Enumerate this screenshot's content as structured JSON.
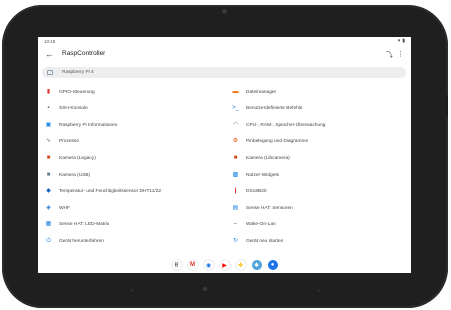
{
  "statusbar": {
    "time": "10:18"
  },
  "appbar": {
    "back": "←",
    "title": "RaspController",
    "action1": "⤵",
    "action2": "⋮"
  },
  "device_selector": {
    "label": "Raspberry Pi 4"
  },
  "menu": {
    "left": [
      {
        "label": "GPIO-Steuerung",
        "icon": "gpio-icon",
        "glyph": "▮",
        "color": "#e53935"
      },
      {
        "label": "SSH-Konsole",
        "icon": "terminal-icon",
        "glyph": "▪",
        "color": "#5f6368"
      },
      {
        "label": "Raspberry Pi Informationen",
        "icon": "info-icon",
        "glyph": "▣",
        "color": "#1e88e5"
      },
      {
        "label": "Prozesse",
        "icon": "activity-icon",
        "glyph": "∿",
        "color": "#5f6368"
      },
      {
        "label": "Kamera (Legacy)",
        "icon": "camera-icon",
        "glyph": "■",
        "color": "#d84315"
      },
      {
        "label": "Kamera (USB)",
        "icon": "webcam-icon",
        "glyph": "■",
        "color": "#607d8b"
      },
      {
        "label": "Temperatur- und Feuchtigkeitssensor DHT11/22",
        "icon": "sensor-icon",
        "glyph": "◆",
        "color": "#1565c0"
      },
      {
        "label": "WHF",
        "icon": "rf-icon",
        "glyph": "◈",
        "color": "#1976d2"
      },
      {
        "label": "Sense HAT: LED-Matrix",
        "icon": "led-matrix-icon",
        "glyph": "▦",
        "color": "#1e88e5"
      },
      {
        "label": "Gerät herunterfahren",
        "icon": "power-icon",
        "glyph": "⏻",
        "color": "#1e88e5"
      }
    ],
    "right": [
      {
        "label": "Dateimanager",
        "icon": "folder-icon",
        "glyph": "▬",
        "color": "#ef6c00"
      },
      {
        "label": "Benutzerdefinierte Befehle",
        "icon": "command-icon",
        "glyph": ">_",
        "color": "#1e88e5"
      },
      {
        "label": "CPU-, RAM-, Speicher-Überwachung",
        "icon": "gauge-icon",
        "glyph": "◠",
        "color": "#5f6368"
      },
      {
        "label": "Pinbelegung und Diagramme",
        "icon": "pinout-icon",
        "glyph": "⚙",
        "color": "#e65100"
      },
      {
        "label": "Kamera (Libcamera)",
        "icon": "camera-icon",
        "glyph": "■",
        "color": "#d84315"
      },
      {
        "label": "Nutzer-Widgets",
        "icon": "widgets-icon",
        "glyph": "▩",
        "color": "#1e88e5"
      },
      {
        "label": "DS18B20",
        "icon": "thermometer-icon",
        "glyph": "❙",
        "color": "#e53935"
      },
      {
        "label": "Sense HAT: Sensoren",
        "icon": "sense-hat-icon",
        "glyph": "▤",
        "color": "#1e88e5"
      },
      {
        "label": "Wake-On-Lan",
        "icon": "wake-icon",
        "glyph": "⇔",
        "color": "#5f6368"
      },
      {
        "label": "Gerät neu starten",
        "icon": "restart-icon",
        "glyph": "↻",
        "color": "#1e88e5"
      }
    ]
  },
  "dock": [
    {
      "name": "apps-grid-icon",
      "glyph": "⠿",
      "bg": "#ffffff",
      "fg": "#555555"
    },
    {
      "name": "gmail-icon",
      "glyph": "M",
      "bg": "#ffffff",
      "fg": "#d93025"
    },
    {
      "name": "chrome-icon",
      "glyph": "◉",
      "bg": "#ffffff",
      "fg": "#1a73e8"
    },
    {
      "name": "youtube-icon",
      "glyph": "▶",
      "bg": "#ffffff",
      "fg": "#ff0000"
    },
    {
      "name": "photos-icon",
      "glyph": "✤",
      "bg": "#ffffff",
      "fg": "#fbbc04"
    },
    {
      "name": "raspcontroller-icon",
      "glyph": "✱",
      "bg": "#4fa3d9",
      "fg": "#ffffff"
    },
    {
      "name": "messages-icon",
      "glyph": "●",
      "bg": "#1a73e8",
      "fg": "#ffffff"
    }
  ]
}
